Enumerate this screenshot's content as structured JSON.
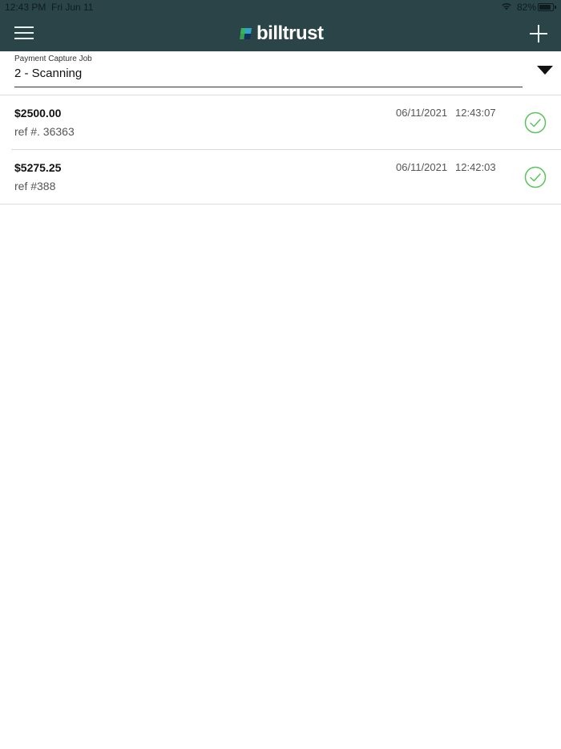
{
  "status_bar": {
    "time": "12:43 PM",
    "date": "Fri Jun 11",
    "battery": "82%"
  },
  "header": {
    "brand": "billtrust",
    "menu_icon": "hamburger-menu-icon",
    "add_icon": "plus-icon",
    "background_color": "#2a4447"
  },
  "job_select": {
    "label": "Payment Capture Job",
    "value": "2 - Scanning"
  },
  "payments": [
    {
      "amount": "$2500.00",
      "ref": "ref #. 36363",
      "date": "06/11/2021",
      "time": "12:43:07",
      "status_icon": "check-circle-icon"
    },
    {
      "amount": "$5275.25",
      "ref": "ref #388",
      "date": "06/11/2021",
      "time": "12:42:03",
      "status_icon": "check-circle-icon"
    }
  ],
  "colors": {
    "success": "#5cc35c"
  }
}
